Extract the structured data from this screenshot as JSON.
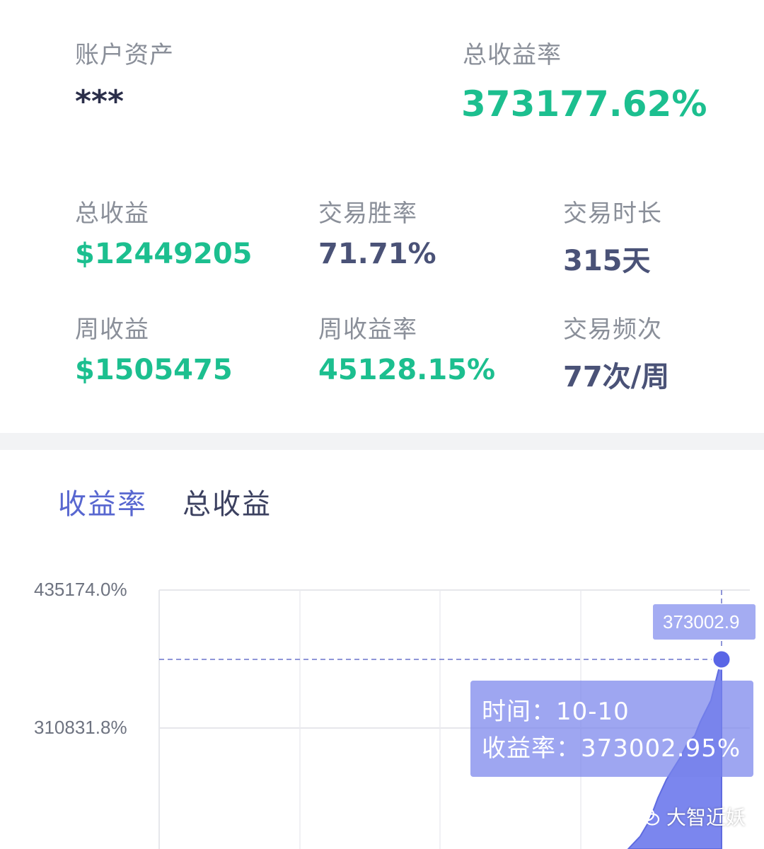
{
  "account": {
    "assets_label": "账户资产",
    "assets_value": "***",
    "total_return_rate_label": "总收益率",
    "total_return_rate_value": "373177.62%"
  },
  "stats": {
    "total_profit_label": "总收益",
    "total_profit_value": "$12449205",
    "win_rate_label": "交易胜率",
    "win_rate_value": "71.71%",
    "duration_label": "交易时长",
    "duration_value": "315天",
    "weekly_profit_label": "周收益",
    "weekly_profit_value": "$1505475",
    "weekly_return_rate_label": "周收益率",
    "weekly_return_rate_value": "45128.15%",
    "frequency_label": "交易频次",
    "frequency_value": "77次/周"
  },
  "tabs": {
    "return_rate": "收益率",
    "total_profit": "总收益"
  },
  "chart": {
    "y_ticks": [
      "435174.0%",
      "310831.8%"
    ],
    "value_tag": "373002.9",
    "tooltip": {
      "time": "时间：10-10",
      "return_rate": "收益率：373002.95%"
    }
  },
  "chart_data": {
    "type": "area",
    "title": "",
    "xlabel": "",
    "ylabel": "",
    "y_axis_ticks": [
      435174.0,
      310831.8
    ],
    "highlighted_point": {
      "x": "10-10",
      "y": 373002.95
    },
    "ylim": [
      0,
      435174.0
    ]
  },
  "watermark": {
    "text": "大智近妖"
  },
  "colors": {
    "green": "#1cbf8f",
    "navy": "#4a5277",
    "accent": "#5867d0",
    "area_fill": "#7b86ee"
  }
}
